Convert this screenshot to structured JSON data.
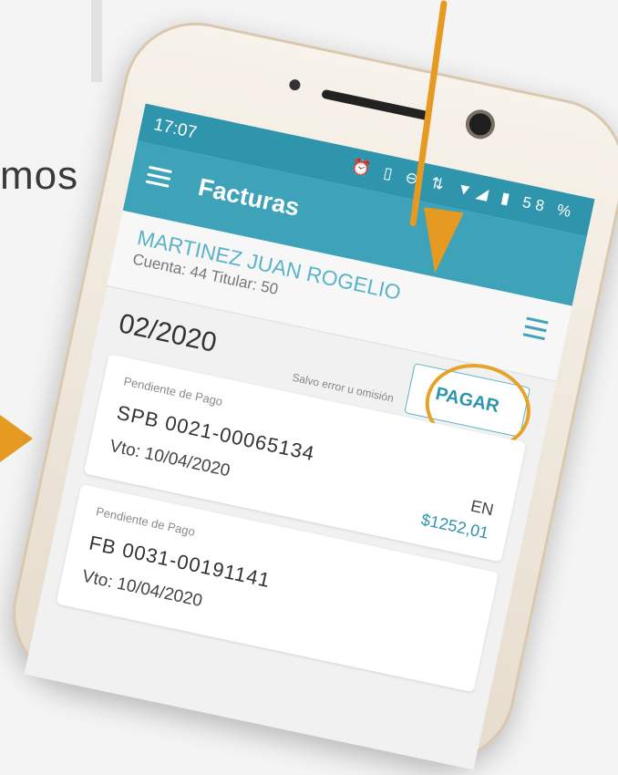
{
  "background": {
    "side_text": "mos"
  },
  "status_bar": {
    "time": "17:07",
    "icons_text": "⏰ ▯ ⊖ ⇅ ▼◢ ▮ 58 %"
  },
  "app_bar": {
    "title": "Facturas"
  },
  "customer": {
    "name": "MARTINEZ JUAN ROGELIO",
    "account": "Cuenta: 44  Titular: 50"
  },
  "period": {
    "date": "02/2020",
    "note": "Salvo error u omisión",
    "pay_button": "PAGAR"
  },
  "invoices": [
    {
      "status": "Pendiente de Pago",
      "number": "SPB 0021-00065134",
      "due": "Vto: 10/04/2020",
      "currency": "EN",
      "amount": "$1252,01"
    },
    {
      "status": "Pendiente de Pago",
      "number": "FB 0031-00191141",
      "due": "Vto: 10/04/2020",
      "currency": "",
      "amount": ""
    }
  ],
  "colors": {
    "primary": "#3ea2b8",
    "accent": "#e79a22",
    "name_text": "#5ab3c8"
  }
}
